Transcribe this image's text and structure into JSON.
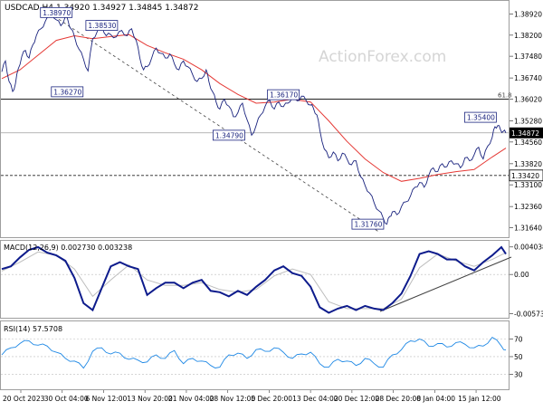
{
  "header": {
    "symbol": "USDCAD,H4",
    "ohlc": "1.34920 1.34927 1.34845 1.34872",
    "watermark": "ActionForex.com"
  },
  "colors": {
    "background": "#ffffff",
    "price_line": "#1a237e",
    "ma_line": "#e53935",
    "macd_line": "#0d1b8c",
    "macd_signal": "#bdbdbd",
    "rsi_line": "#1e88e5",
    "current_price_box": "#000000",
    "box_border": "#1a237e"
  },
  "chart_data": [
    {
      "type": "line",
      "panel": "price",
      "title": "USDCAD,H4",
      "y_axis": {
        "ticks": [
          "1.38920",
          "1.38200",
          "1.37480",
          "1.36740",
          "1.36020",
          "1.35280",
          "1.34560",
          "1.33820",
          "1.33100",
          "1.32360",
          "1.31640"
        ],
        "tick_values": [
          1.3892,
          1.382,
          1.3748,
          1.3674,
          1.3602,
          1.3528,
          1.3456,
          1.3382,
          1.331,
          1.3236,
          1.3164
        ],
        "ylim": [
          1.3144,
          1.3915
        ]
      },
      "x_axis": {
        "ticks": [
          "20 Oct 2023",
          "30 Oct 04:00",
          "6 Nov 12:00",
          "13 Nov 20:00",
          "21 Nov 04:00",
          "28 Nov 12:00",
          "5 Dec 20:00",
          "13 Dec 04:00",
          "20 Dec 12:00",
          "28 Dec 20:00",
          "8 Jan 04:00",
          "15 Jan 12:00"
        ]
      },
      "series": [
        {
          "role": "price",
          "x": [
            0,
            4,
            8,
            12,
            15,
            18,
            22,
            26,
            30,
            34,
            38,
            43,
            48,
            55,
            60,
            65,
            70,
            73,
            76,
            80,
            85,
            90,
            95,
            100,
            105,
            110,
            115,
            120,
            126,
            132,
            138,
            143,
            148,
            152,
            156,
            160,
            165,
            170,
            175,
            180,
            185,
            190,
            195,
            200,
            205,
            210,
            215,
            220,
            225,
            228,
            232,
            236,
            240,
            245,
            250,
            255,
            260,
            265,
            270,
            275,
            280,
            285,
            290,
            295,
            300,
            305,
            310,
            315,
            320,
            325,
            330,
            335,
            340,
            343,
            347,
            350,
            355,
            360,
            365,
            370,
            375,
            380,
            385,
            390,
            395,
            400,
            405,
            410,
            415,
            420,
            424,
            427,
            430,
            435,
            440,
            445,
            450,
            455,
            460,
            465,
            470,
            475,
            480,
            485,
            490,
            495,
            500,
            505,
            510,
            515,
            520,
            525,
            530,
            535,
            540,
            543,
            546,
            549,
            552,
            555
          ],
          "y": [
            1.3695,
            1.3732,
            1.3662,
            1.3628,
            1.3655,
            1.3705,
            1.3748,
            1.3768,
            1.3742,
            1.3786,
            1.3818,
            1.3842,
            1.3868,
            1.3897,
            1.3872,
            1.3852,
            1.3884,
            1.3868,
            1.3842,
            1.3815,
            1.3772,
            1.3738,
            1.3698,
            1.3808,
            1.3832,
            1.3853,
            1.3818,
            1.3822,
            1.3814,
            1.3836,
            1.3818,
            1.3842,
            1.3802,
            1.3742,
            1.3702,
            1.3712,
            1.3742,
            1.3776,
            1.3758,
            1.3742,
            1.3756,
            1.3722,
            1.3702,
            1.3732,
            1.3712,
            1.3686,
            1.3662,
            1.3672,
            1.3702,
            1.3662,
            1.3628,
            1.3592,
            1.3568,
            1.3602,
            1.3578,
            1.3542,
            1.3556,
            1.3588,
            1.3532,
            1.3479,
            1.3512,
            1.3548,
            1.3578,
            1.3598,
            1.3568,
            1.3592,
            1.3576,
            1.3588,
            1.3612,
            1.3596,
            1.3612,
            1.3598,
            1.3582,
            1.3572,
            1.3548,
            1.3498,
            1.3432,
            1.3402,
            1.3422,
            1.3392,
            1.3418,
            1.3398,
            1.3378,
            1.3392,
            1.3338,
            1.3308,
            1.3282,
            1.3248,
            1.3222,
            1.3196,
            1.3176,
            1.3202,
            1.3218,
            1.3208,
            1.3236,
            1.3252,
            1.3272,
            1.3302,
            1.3318,
            1.3302,
            1.3342,
            1.3368,
            1.3355,
            1.3382,
            1.3372,
            1.3392,
            1.3382,
            1.3368,
            1.3402,
            1.3392,
            1.3412,
            1.3438,
            1.3398,
            1.3442,
            1.3472,
            1.3508,
            1.3512,
            1.3498,
            1.3492,
            1.3487
          ]
        },
        {
          "role": "moving-average",
          "x": [
            0,
            20,
            40,
            60,
            80,
            100,
            120,
            140,
            160,
            180,
            200,
            220,
            240,
            260,
            280,
            300,
            320,
            340,
            360,
            380,
            400,
            420,
            440,
            460,
            480,
            500,
            520,
            540,
            555
          ],
          "y": [
            1.3672,
            1.3702,
            1.3752,
            1.3802,
            1.3818,
            1.3808,
            1.3815,
            1.3822,
            1.3785,
            1.376,
            1.3738,
            1.3702,
            1.3655,
            1.3618,
            1.3588,
            1.3592,
            1.3602,
            1.3592,
            1.3528,
            1.3458,
            1.3398,
            1.3352,
            1.3322,
            1.3332,
            1.3345,
            1.3355,
            1.3362,
            1.3405,
            1.3435
          ]
        }
      ],
      "annotations": {
        "price_labels": [
          "1.38970",
          "1.38530",
          "1.36270",
          "1.36170",
          "1.34790",
          "1.35400",
          "1.31760"
        ],
        "fib_label": "61.8",
        "horizontal_levels": [
          1.3602,
          1.3487,
          1.3342
        ],
        "current_price": "1.34872",
        "support_price": "1.33420"
      }
    },
    {
      "type": "line",
      "panel": "macd",
      "title": "MACD(12,26,9) 0.002730 0.003238",
      "y_axis": {
        "ticks": [
          "0.004038",
          "0.00",
          "-0.005737"
        ],
        "ylim": [
          -0.0062,
          0.0044
        ]
      },
      "series": [
        {
          "role": "macd",
          "x": [
            0,
            10,
            20,
            30,
            40,
            50,
            60,
            70,
            80,
            90,
            100,
            110,
            120,
            130,
            140,
            150,
            160,
            170,
            180,
            190,
            200,
            210,
            220,
            230,
            240,
            250,
            260,
            270,
            280,
            290,
            300,
            310,
            320,
            330,
            340,
            350,
            360,
            370,
            380,
            390,
            400,
            410,
            420,
            430,
            440,
            450,
            460,
            470,
            480,
            490,
            500,
            510,
            520,
            530,
            540,
            550,
            555
          ],
          "y": [
            0.0008,
            0.0012,
            0.0025,
            0.0036,
            0.004,
            0.0032,
            0.0028,
            0.002,
            -0.0005,
            -0.0042,
            -0.0052,
            -0.002,
            0.0012,
            0.0018,
            0.0012,
            0.0008,
            -0.003,
            -0.002,
            -0.0012,
            -0.0012,
            -0.002,
            -0.0012,
            -0.0008,
            -0.0024,
            -0.0026,
            -0.0032,
            -0.0024,
            -0.003,
            -0.0018,
            -0.0008,
            0.0006,
            0.0012,
            0.0002,
            -0.0002,
            -0.0018,
            -0.0048,
            -0.0056,
            -0.005,
            -0.0046,
            -0.0052,
            -0.0046,
            -0.005,
            -0.0052,
            -0.0042,
            -0.0028,
            -0.0002,
            0.003,
            0.0034,
            0.003,
            0.0022,
            0.0022,
            0.0012,
            0.0006,
            0.0018,
            0.0028,
            0.004,
            0.003
          ]
        },
        {
          "role": "signal",
          "x": [
            0,
            20,
            40,
            60,
            80,
            100,
            120,
            140,
            160,
            180,
            200,
            220,
            240,
            260,
            280,
            300,
            320,
            340,
            360,
            380,
            400,
            420,
            440,
            460,
            480,
            500,
            520,
            540,
            555
          ],
          "y": [
            0.0005,
            0.0018,
            0.0033,
            0.0028,
            0.0008,
            -0.0032,
            -0.0008,
            0.0014,
            -0.0008,
            -0.0016,
            -0.0016,
            -0.0012,
            -0.0022,
            -0.0026,
            -0.0022,
            -0.0002,
            0.0008,
            0.0,
            -0.004,
            -0.005,
            -0.005,
            -0.005,
            -0.0036,
            0.001,
            0.003,
            0.002,
            0.0012,
            0.0022,
            0.0032
          ]
        }
      ],
      "annotations": {
        "trendline": "rising support from Dec low"
      }
    },
    {
      "type": "line",
      "panel": "rsi",
      "title": "RSI(14) 57.5708",
      "y_axis": {
        "ticks": [
          "70",
          "50",
          "30"
        ],
        "ylim": [
          15,
          88
        ]
      },
      "series": [
        {
          "role": "rsi",
          "x": [
            0,
            10,
            20,
            30,
            40,
            50,
            60,
            70,
            80,
            90,
            100,
            110,
            120,
            130,
            140,
            150,
            160,
            170,
            180,
            190,
            200,
            210,
            220,
            230,
            240,
            250,
            260,
            270,
            280,
            290,
            300,
            310,
            320,
            330,
            340,
            350,
            360,
            370,
            380,
            390,
            400,
            410,
            420,
            430,
            440,
            450,
            460,
            470,
            480,
            490,
            500,
            510,
            520,
            530,
            540,
            550,
            555
          ],
          "y": [
            52,
            60,
            65,
            68,
            63,
            62,
            55,
            48,
            45,
            37,
            56,
            60,
            53,
            54,
            47,
            46,
            44,
            52,
            48,
            57,
            42,
            48,
            45,
            40,
            38,
            52,
            54,
            48,
            58,
            56,
            60,
            55,
            48,
            53,
            55,
            42,
            38,
            47,
            45,
            40,
            48,
            42,
            38,
            52,
            58,
            68,
            70,
            62,
            65,
            61,
            66,
            64,
            60,
            62,
            72,
            62,
            57.6
          ]
        }
      ]
    }
  ]
}
